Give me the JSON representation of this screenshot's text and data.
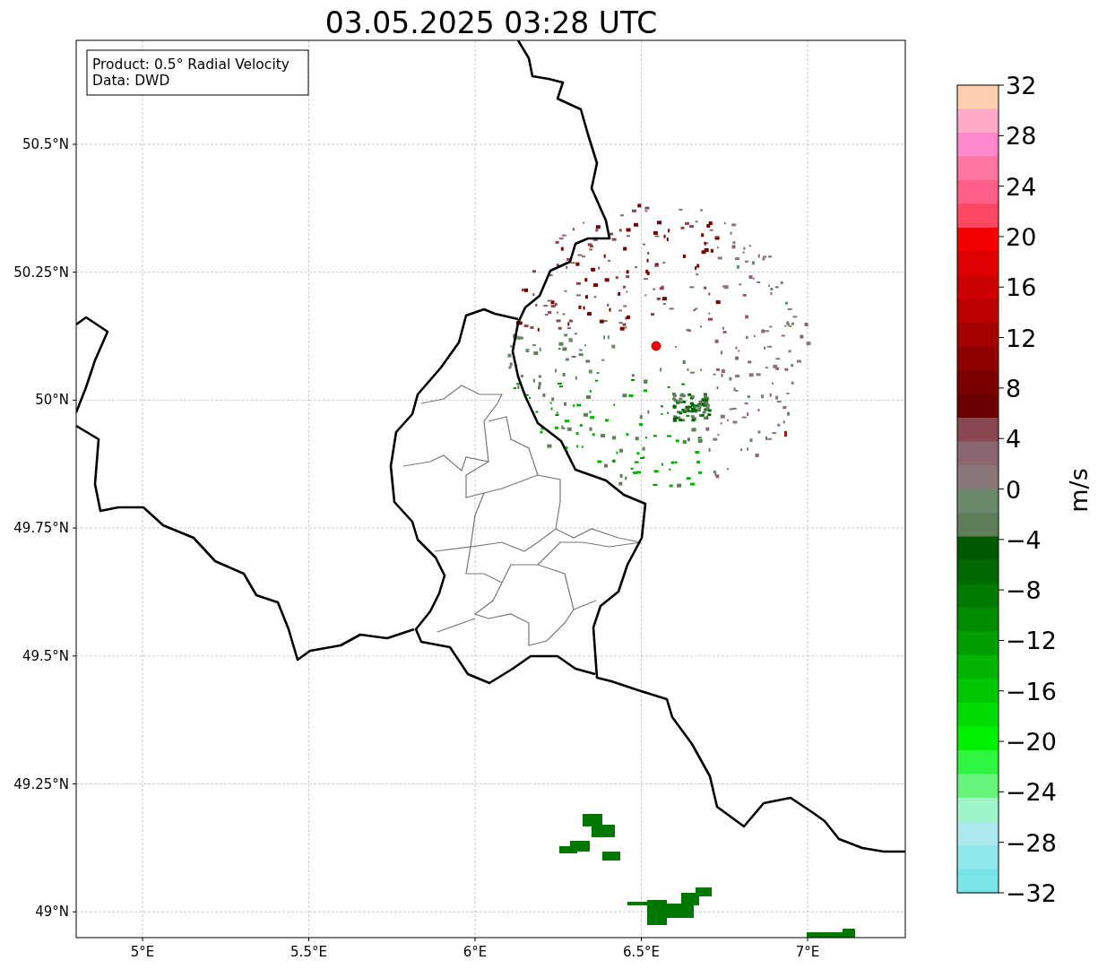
{
  "title": "03.05.2025 03:28 UTC",
  "info_box": {
    "lines": [
      "Product: 0.5° Radial Velocity",
      "Data: DWD"
    ]
  },
  "map": {
    "x_ticks": [
      "5°E",
      "5.5°E",
      "6°E",
      "6.5°E",
      "7°E"
    ],
    "y_ticks": [
      "50.5°N",
      "50.25°N",
      "50°N",
      "49.75°N",
      "49.5°N",
      "49.25°N",
      "49°N"
    ]
  },
  "colorbar": {
    "label": "m/s",
    "ticks": [
      "32",
      "28",
      "24",
      "20",
      "16",
      "12",
      "8",
      "4",
      "0",
      "−4",
      "−8",
      "−12",
      "−16",
      "−20",
      "−24",
      "−28",
      "−32"
    ],
    "segments": [
      {
        "color": "#ffd0b0"
      },
      {
        "color": "#ffa8c8"
      },
      {
        "color": "#ff88cc"
      },
      {
        "color": "#ff75a0"
      },
      {
        "color": "#ff5f86"
      },
      {
        "color": "#ff4662"
      },
      {
        "color": "#f50000"
      },
      {
        "color": "#de0000"
      },
      {
        "color": "#cc0000"
      },
      {
        "color": "#bb0000"
      },
      {
        "color": "#a50000"
      },
      {
        "color": "#900000"
      },
      {
        "color": "#7b0000"
      },
      {
        "color": "#6a0000"
      },
      {
        "color": "#884850"
      },
      {
        "color": "#8a6670"
      },
      {
        "color": "#8a7878"
      },
      {
        "color": "#6b8a6b"
      },
      {
        "color": "#5f7f5a"
      },
      {
        "color": "#005a00"
      },
      {
        "color": "#006800"
      },
      {
        "color": "#007a00"
      },
      {
        "color": "#008c00"
      },
      {
        "color": "#009e00"
      },
      {
        "color": "#00b400"
      },
      {
        "color": "#00c800"
      },
      {
        "color": "#00dc00"
      },
      {
        "color": "#00f000"
      },
      {
        "color": "#30f540"
      },
      {
        "color": "#66f57a"
      },
      {
        "color": "#9ef5c8"
      },
      {
        "color": "#ade8ee"
      },
      {
        "color": "#8ee8ec"
      },
      {
        "color": "#7ae5e8"
      }
    ]
  }
}
